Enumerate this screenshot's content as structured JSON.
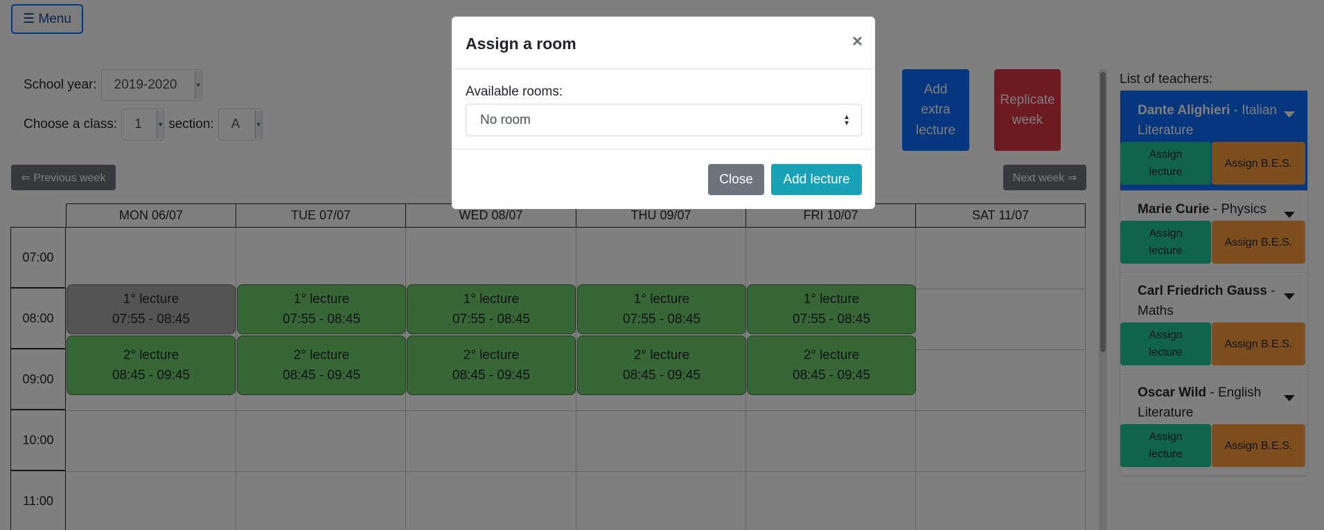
{
  "menu_label": "☰ Menu",
  "filters": {
    "school_year_label": "School year:",
    "school_year_value": "2019-2020",
    "class_label": "Choose a class:",
    "class_value": "1",
    "section_label": "section:",
    "section_value": "A"
  },
  "nav": {
    "prev_week": "⇐ Previous week",
    "next_week": "Next week ⇒"
  },
  "actions": {
    "add_extra_lecture": "Add extra lecture",
    "replicate_week": "Replicate week"
  },
  "colors": {
    "primary": "#0d6efd",
    "lecture_green": "#6fcf6f",
    "teal": "#20c997",
    "orange": "#fd9f3d",
    "danger": "#dc3545"
  },
  "days": [
    "MON 06/07",
    "TUE 07/07",
    "WED 08/07",
    "THU 09/07",
    "FRI 10/07",
    "SAT 11/07"
  ],
  "times": [
    "07:00",
    "08:00",
    "09:00",
    "10:00",
    "11:00"
  ],
  "lectures": {
    "first": {
      "name": "1° lecture",
      "time": "07:55 - 08:45"
    },
    "second": {
      "name": "2° lecture",
      "time": "08:45 - 09:45"
    }
  },
  "teachers": {
    "label": "List of teachers:",
    "assign_lecture": "Assign lecture",
    "assign_bes": "Assign B.E.S.",
    "items": [
      {
        "name": "Dante Alighieri",
        "subject": "- Italian Literature"
      },
      {
        "name": "Marie Curie",
        "subject": "- Physics"
      },
      {
        "name": "Carl Friedrich Gauss",
        "subject": "- Maths"
      },
      {
        "name": "Oscar Wild",
        "subject": "- English Literature"
      }
    ]
  },
  "modal": {
    "title": "Assign a room",
    "close_symbol": "×",
    "rooms_label": "Available rooms:",
    "rooms_value": "No room",
    "close_button": "Close",
    "add_button": "Add lecture"
  }
}
